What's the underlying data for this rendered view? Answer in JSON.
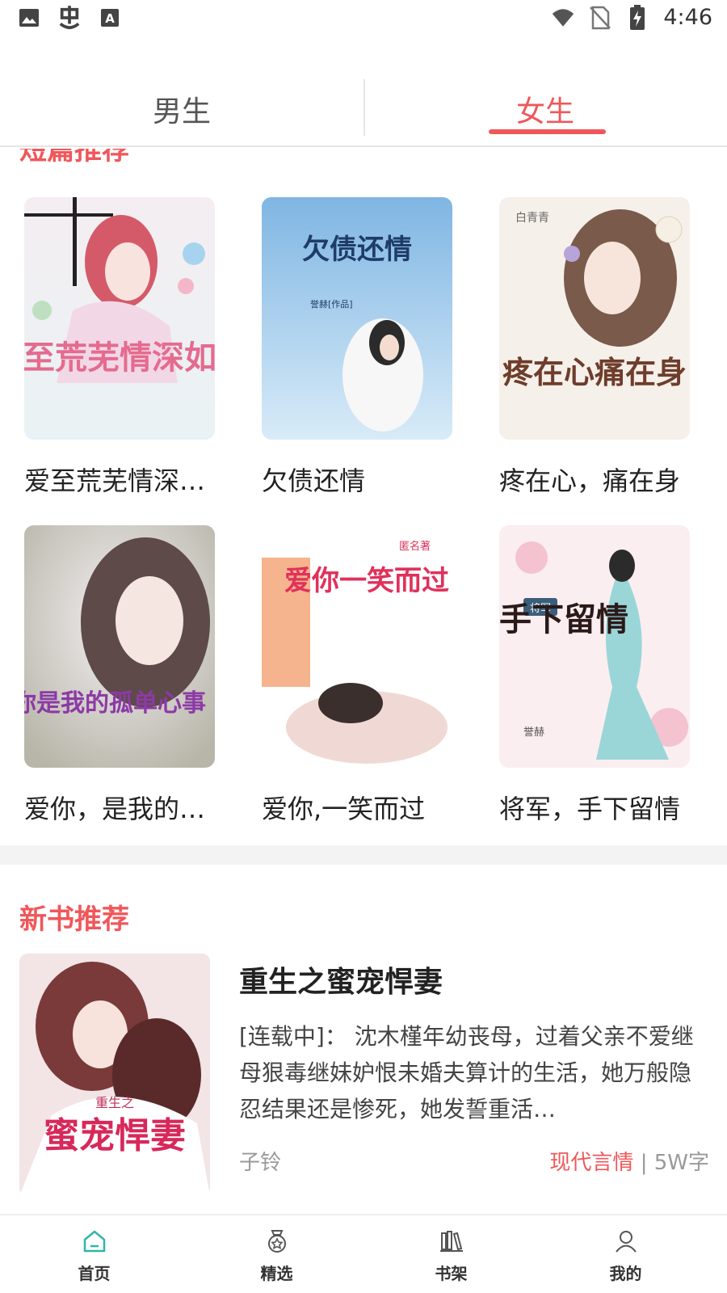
{
  "status_bar": {
    "time": "4:46",
    "left_icons": [
      "image-icon",
      "bug-icon",
      "font-icon"
    ],
    "right_icons": [
      "wifi-icon",
      "no-sim-icon",
      "battery-charging-icon"
    ]
  },
  "tabs": {
    "items": [
      {
        "label": "男生",
        "active": false
      },
      {
        "label": "女生",
        "active": true
      }
    ],
    "active_color": "#f0575a"
  },
  "sections": {
    "short": {
      "title": "短篇推荐",
      "books": [
        {
          "title": "爱至荒芜情深如烟",
          "cover_text": "爱至荒芜情深如烟"
        },
        {
          "title": "欠债还情",
          "cover_text": "欠债还情",
          "cover_author": "誉赫[作品]"
        },
        {
          "title": "疼在心，痛在身",
          "cover_text": "疼在心痛在身",
          "cover_author": "白青青"
        },
        {
          "title": "爱你，是我的孤单心事",
          "cover_text": "爱你是我的孤单心事"
        },
        {
          "title": "爱你,一笑而过",
          "cover_text": "爱你一笑而过",
          "cover_author": "匿名著"
        },
        {
          "title": "将军，手下留情",
          "cover_text": "手下留情",
          "cover_badge": "将军",
          "cover_author": "誉赫"
        }
      ]
    },
    "new_books": {
      "title": "新书推荐",
      "featured": {
        "title": "重生之蜜宠悍妻",
        "description": "[连载中]： 沈木槿年幼丧母，过着父亲不爱继母狠毒继妹妒恨未婚夫算计的生活，她万般隐忍结果还是惨死，她发誓重活…",
        "author": "子铃",
        "genre": "现代言情",
        "separator": " | ",
        "word_count": "5W字",
        "cover_text": "蜜宠悍妻",
        "cover_subtitle": "重生之"
      }
    }
  },
  "bottom_nav": {
    "items": [
      {
        "label": "首页",
        "icon": "home-icon",
        "active": true
      },
      {
        "label": "精选",
        "icon": "badge-icon",
        "active": false
      },
      {
        "label": "书架",
        "icon": "bookshelf-icon",
        "active": false
      },
      {
        "label": "我的",
        "icon": "user-icon",
        "active": false
      }
    ]
  },
  "colors": {
    "accent": "#f0575a",
    "active_icon": "#2fb6a8"
  }
}
